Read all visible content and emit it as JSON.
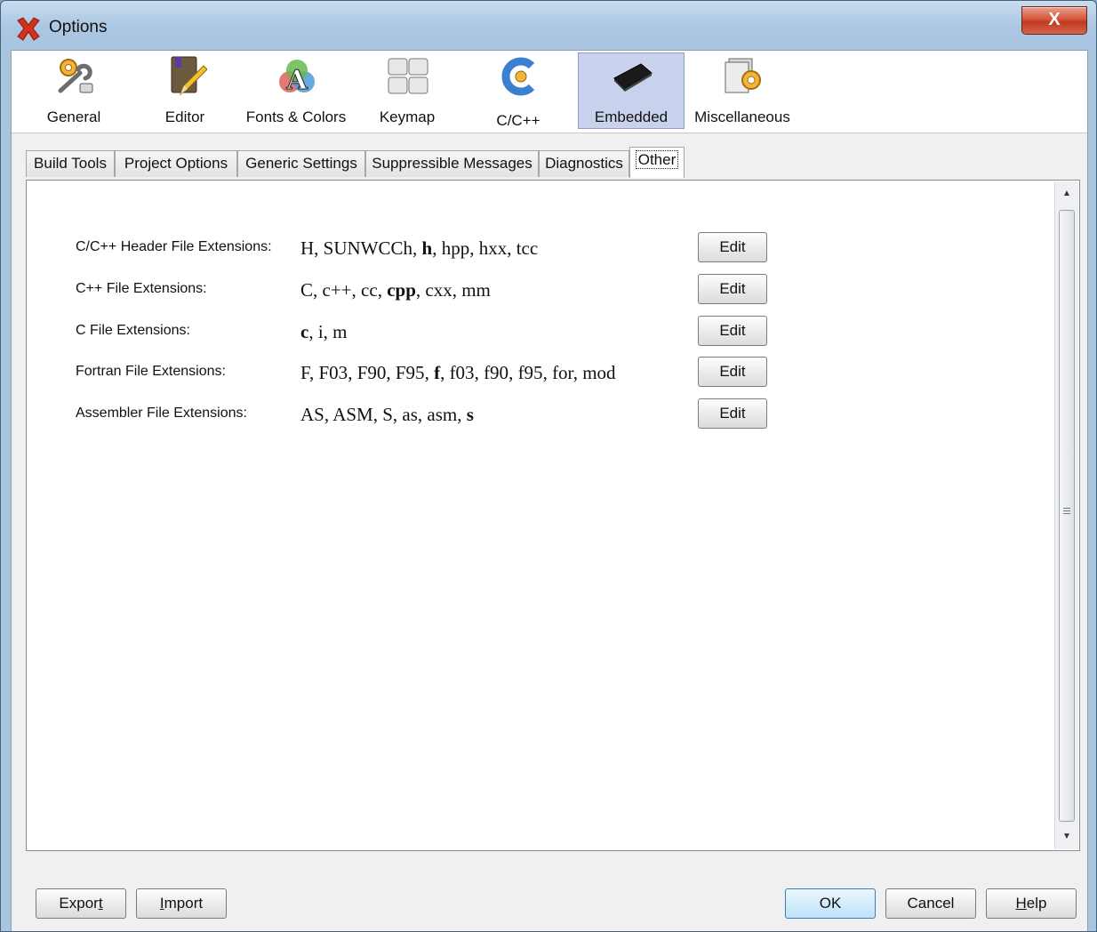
{
  "window": {
    "title": "Options",
    "close_label": "X"
  },
  "categories": [
    {
      "id": "general",
      "label": "General",
      "icon": "general-settings-icon"
    },
    {
      "id": "editor",
      "label": "Editor",
      "icon": "editor-icon"
    },
    {
      "id": "fonts-colors",
      "label": "Fonts & Colors",
      "icon": "fonts-colors-icon"
    },
    {
      "id": "keymap",
      "label": "Keymap",
      "icon": "keymap-icon"
    },
    {
      "id": "cpp",
      "label": "C/C++",
      "icon": "cpp-icon"
    },
    {
      "id": "embedded",
      "label": "Embedded",
      "icon": "chip-icon",
      "selected": true
    },
    {
      "id": "misc",
      "label": "Miscellaneous",
      "icon": "miscellaneous-icon"
    }
  ],
  "tabs": [
    {
      "label": "Build Tools"
    },
    {
      "label": "Project Options"
    },
    {
      "label": "Generic Settings"
    },
    {
      "label": "Suppressible Messages"
    },
    {
      "label": "Diagnostics"
    },
    {
      "label": "Other",
      "active": true
    }
  ],
  "rows": [
    {
      "label": "C/C++ Header File Extensions:",
      "values": [
        [
          "H",
          false
        ],
        [
          "SUNWCCh",
          false
        ],
        [
          "h",
          true
        ],
        [
          "hpp",
          false
        ],
        [
          "hxx",
          false
        ],
        [
          "tcc",
          false
        ]
      ],
      "button": "Edit"
    },
    {
      "label": "C++ File Extensions:",
      "values": [
        [
          "C",
          false
        ],
        [
          "c++",
          false
        ],
        [
          "cc",
          false
        ],
        [
          "cpp",
          true
        ],
        [
          "cxx",
          false
        ],
        [
          "mm",
          false
        ]
      ],
      "button": "Edit"
    },
    {
      "label": "C File Extensions:",
      "values": [
        [
          "c",
          true
        ],
        [
          "i",
          false
        ],
        [
          "m",
          false
        ]
      ],
      "button": "Edit"
    },
    {
      "label": "Fortran File Extensions:",
      "values": [
        [
          "F",
          false
        ],
        [
          "F03",
          false
        ],
        [
          "F90",
          false
        ],
        [
          "F95",
          false
        ],
        [
          "f",
          true
        ],
        [
          "f03",
          false
        ],
        [
          "f90",
          false
        ],
        [
          "f95",
          false
        ],
        [
          "for",
          false
        ],
        [
          "mod",
          false
        ]
      ],
      "button": "Edit"
    },
    {
      "label": "Assembler File Extensions:",
      "values": [
        [
          "AS",
          false
        ],
        [
          "ASM",
          false
        ],
        [
          "S",
          false
        ],
        [
          "as",
          false
        ],
        [
          "asm",
          false
        ],
        [
          "s",
          true
        ]
      ],
      "button": "Edit"
    }
  ],
  "footer": {
    "export": {
      "text": "Expor",
      "mnemonic": "t"
    },
    "import": {
      "mnemonic": "I",
      "text": "mport"
    },
    "ok": "OK",
    "cancel": "Cancel",
    "help": {
      "mnemonic": "H",
      "text": "elp"
    }
  },
  "colors": {
    "selected_category": "#c8d2ec",
    "ok_button": "#d3ecfb"
  }
}
